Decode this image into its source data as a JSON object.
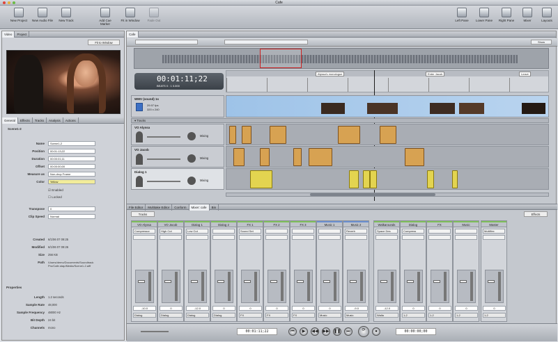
{
  "window": {
    "title": "Cafe"
  },
  "toolbar": {
    "left": [
      {
        "label": "New Project",
        "icon": "new-project-icon"
      },
      {
        "label": "New Audio File",
        "icon": "new-audio-file-icon"
      },
      {
        "label": "New Track",
        "icon": "new-track-icon"
      },
      {
        "label": "Add Cue Marker",
        "icon": "marker-icon"
      },
      {
        "label": "Fit in Window",
        "icon": "fit-window-icon"
      },
      {
        "label": "Fade Out",
        "icon": "fade-icon"
      }
    ],
    "right": [
      {
        "label": "Left Pane",
        "icon": "left-pane-icon"
      },
      {
        "label": "Lower Pane",
        "icon": "lower-pane-icon"
      },
      {
        "label": "Right Pane",
        "icon": "right-pane-icon"
      },
      {
        "label": "Mixer",
        "icon": "mixer-icon"
      },
      {
        "label": "Layouts",
        "icon": "layouts-icon"
      }
    ]
  },
  "left_pane": {
    "top_tabs": [
      "Video",
      "Project"
    ],
    "fit_menu": "Fit to Window",
    "inspector_tabs": [
      "General",
      "Effects",
      "Tracks",
      "Analysis",
      "Actions"
    ],
    "clip_title": "Scene1-2",
    "rows": [
      {
        "key": "Name",
        "value": "Scene1-2"
      },
      {
        "key": "Position",
        "value": "00:01:13;22"
      },
      {
        "key": "Duration",
        "value": "00:00:01;11"
      },
      {
        "key": "Offset",
        "value": "00:00:00;00"
      },
      {
        "key": "Measure as",
        "value": "Non-drop Frame"
      },
      {
        "key": "Color",
        "value": "Yellow"
      }
    ],
    "checks": [
      "Enabled",
      "Locked"
    ],
    "rows2": [
      {
        "key": "Transpose",
        "value": "0"
      },
      {
        "key": "Clip Speed",
        "value": "Normal"
      }
    ],
    "info_rows": [
      {
        "key": "Created",
        "value": "6/1/06 07 09:25"
      },
      {
        "key": "Modified",
        "value": "6/1/06 07 09:26"
      },
      {
        "key": "Size",
        "value": "256 KB"
      },
      {
        "key": "Path",
        "value": "/Users/demo/Documents/Soundtrack Pro/Cafe.stap/Media/Scene1-2.aiff"
      }
    ],
    "properties_title": "Properties",
    "props": [
      {
        "key": "Length",
        "value": "1.2 seconds"
      },
      {
        "key": "Sample Rate",
        "value": "48,000"
      },
      {
        "key": "Sample Frequency",
        "value": "48000 Hz"
      },
      {
        "key": "Bit Depth",
        "value": "24 bit"
      },
      {
        "key": "Channels",
        "value": "mono"
      }
    ]
  },
  "main": {
    "tab": "Cafe",
    "view_menu": "Show",
    "timecode": "00:01:11;22",
    "timecode_sub": "BEATS 0 : 1 0.000",
    "markers": [
      "Alyssa's monologue",
      "Enter Jacob",
      "Leave"
    ],
    "video_track": {
      "name": "WMV (sound) 1s",
      "info": "29.97 fps",
      "sub": "320 x 240"
    },
    "tracks_label": "Tracks",
    "tracks": [
      {
        "name": "VO Alyssa",
        "mode": "Mixing"
      },
      {
        "name": "VO Jacob",
        "mode": "Mixing"
      },
      {
        "name": "Dialog 1",
        "mode": "Mixing"
      }
    ],
    "bottom_tabs": [
      "File Editor",
      "Multitake Editor",
      "Conform",
      "Mixer: cafe",
      "Bin"
    ],
    "mixer_view_label": "Tracks",
    "mixer_menu": "Effects",
    "strips": [
      {
        "name": "VO Alyssa",
        "fx": "Compressor",
        "vol": "-10.0",
        "out": "Dialog"
      },
      {
        "name": "VO Jacob",
        "fx": "High Cut",
        "vol": "0",
        "out": "Dialog"
      },
      {
        "name": "Dialog 1",
        "fx": "Low Cut",
        "vol": "-12.0",
        "out": "Dialog"
      },
      {
        "name": "Dialog 2",
        "fx": "",
        "vol": "0",
        "out": "Dialog"
      },
      {
        "name": "FX 1",
        "fx": "Sound Set",
        "vol": "0",
        "out": "FX"
      },
      {
        "name": "FX 2",
        "fx": "",
        "vol": "0",
        "out": "FX"
      },
      {
        "name": "FX 3",
        "fx": "",
        "vol": "0",
        "out": "FX"
      },
      {
        "name": "Music 1",
        "fx": "",
        "vol": "0",
        "out": "Music"
      },
      {
        "name": "Music 2",
        "fx": "Reverb",
        "vol": "-9.0",
        "out": "Music"
      },
      {
        "name": "Walkarounds",
        "fx": "Space Des",
        "vol": "-12.0",
        "out": "Walla"
      },
      {
        "name": "Dialog",
        "fx": "Compress",
        "vol": "0",
        "out": "1-2"
      },
      {
        "name": "FX",
        "fx": "",
        "vol": "0",
        "out": "1-2"
      },
      {
        "name": "Music",
        "fx": "",
        "vol": "0",
        "out": "1-2"
      },
      {
        "name": "Master",
        "fx": "Multiflex",
        "vol": "0",
        "out": "1-2"
      }
    ],
    "transport_tc": "00:01:11;22",
    "transport_end": "00:00:00;00"
  }
}
